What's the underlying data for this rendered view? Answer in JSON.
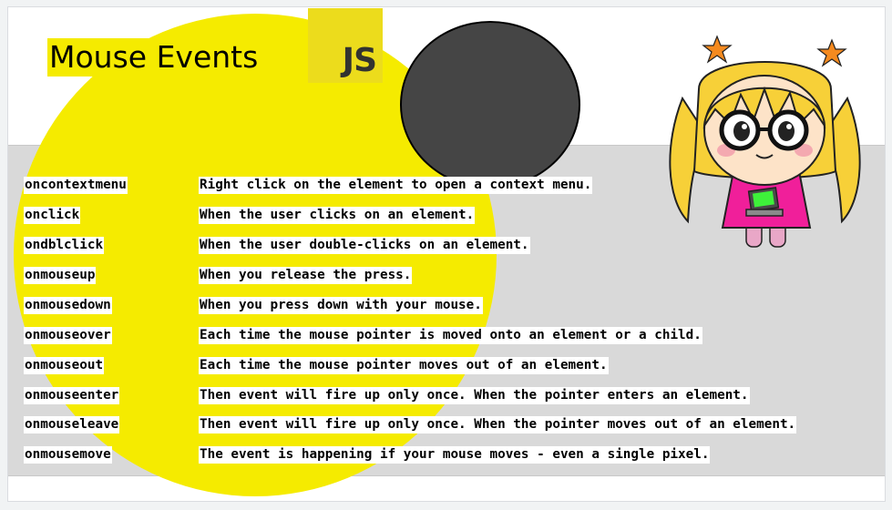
{
  "slide": {
    "title": "Mouse Events",
    "logo_text": "JS"
  },
  "events": [
    {
      "name": "oncontextmenu",
      "description": "Right click on the element to open a context menu."
    },
    {
      "name": "onclick",
      "description": "When the user clicks on an element."
    },
    {
      "name": "ondblclick",
      "description": "When the user double-clicks on an element."
    },
    {
      "name": "onmouseup",
      "description": "When you release the press."
    },
    {
      "name": "onmousedown",
      "description": "When you press down with your mouse."
    },
    {
      "name": "onmouseover",
      "description": "Each time  the mouse pointer is moved onto an element or a child."
    },
    {
      "name": "onmouseout",
      "description": "Each time the mouse pointer moves out of an element."
    },
    {
      "name": "onmouseenter",
      "description": "Then event will fire up only once. When the pointer enters an element."
    },
    {
      "name": "onmouseleave",
      "description": "Then event will fire up only once. When the pointer moves out of an element."
    },
    {
      "name": "onmousemove",
      "description": "The event is happening if your mouse moves - even a single pixel."
    }
  ],
  "colors": {
    "yellow_circle": "#f5eb00",
    "js_logo_bg": "#ecdc1c",
    "dark_circle": "#454545",
    "gray_band": "#d9d9d9"
  },
  "icons": {
    "mascot": "cartoon-girl-with-glasses-and-laptop-icon"
  }
}
